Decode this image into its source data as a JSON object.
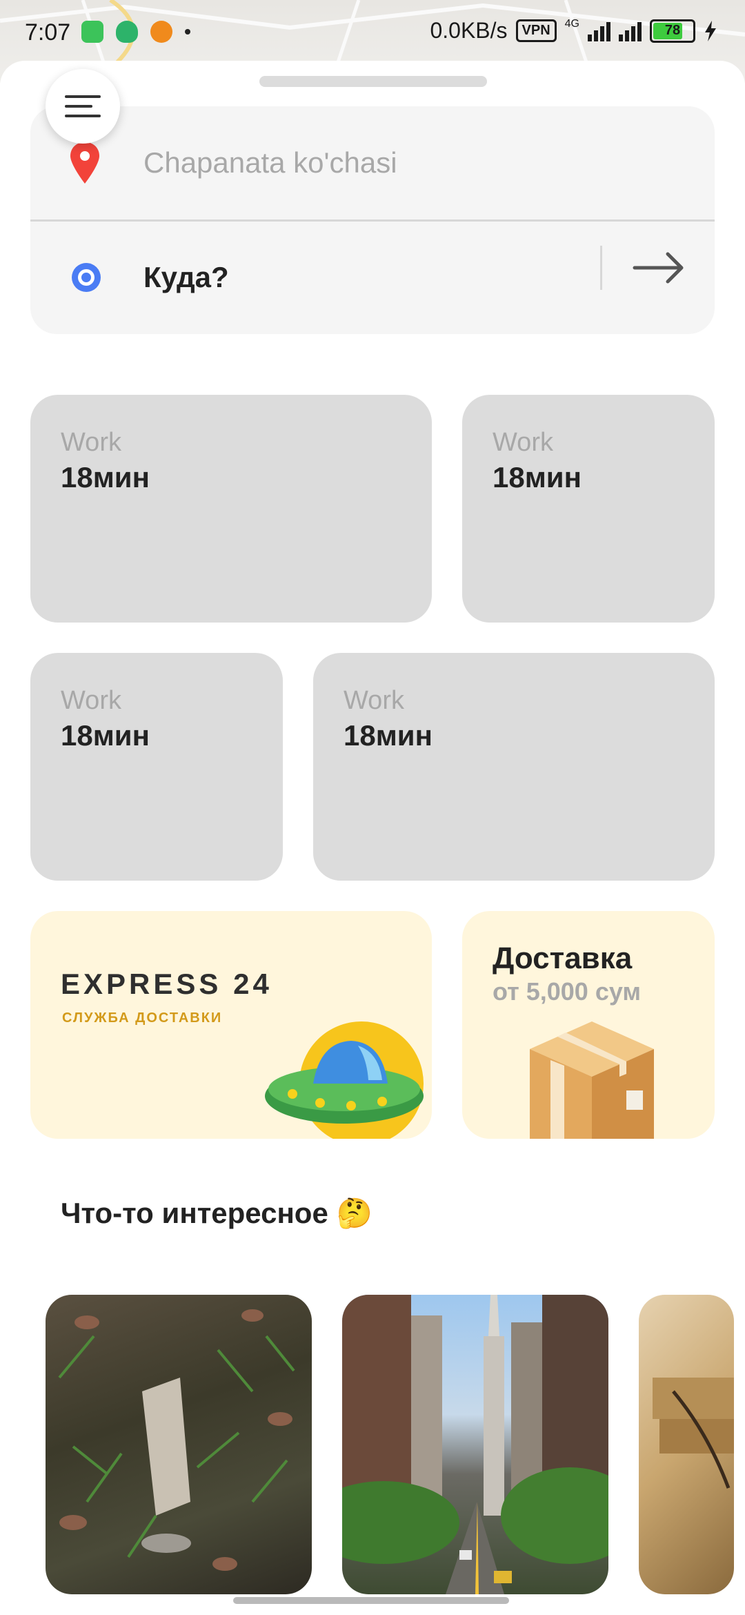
{
  "status_bar": {
    "time": "7:07",
    "network_speed": "0.0KB/s",
    "vpn": "VPN",
    "network_type": "4G",
    "battery": "78"
  },
  "route": {
    "from": "Chapanata ko'chasi",
    "to_placeholder": "Куда?"
  },
  "tiles": [
    {
      "label": "Work",
      "value": "18мин"
    },
    {
      "label": "Work",
      "value": "18мин"
    },
    {
      "label": "Work",
      "value": "18мин"
    },
    {
      "label": "Work",
      "value": "18мин"
    }
  ],
  "promos": {
    "express": {
      "title": "EXPRESS 24",
      "subtitle": "СЛУЖБА ДОСТАВКИ"
    },
    "delivery": {
      "title": "Доставка",
      "subtitle": "от 5,000 сум"
    }
  },
  "interesting": {
    "title": "Что-то интересное 🤔"
  },
  "icons": {
    "menu": "hamburger-menu-icon",
    "from": "location-pin-icon",
    "to": "target-dot-icon",
    "go": "arrow-right-icon"
  },
  "colors": {
    "pin_red": "#f2433a",
    "target_blue": "#4a7cf4",
    "tile_gray": "#dcdcdc",
    "promo_cream": "#fff6dc",
    "express_gold": "#d39a1a"
  }
}
